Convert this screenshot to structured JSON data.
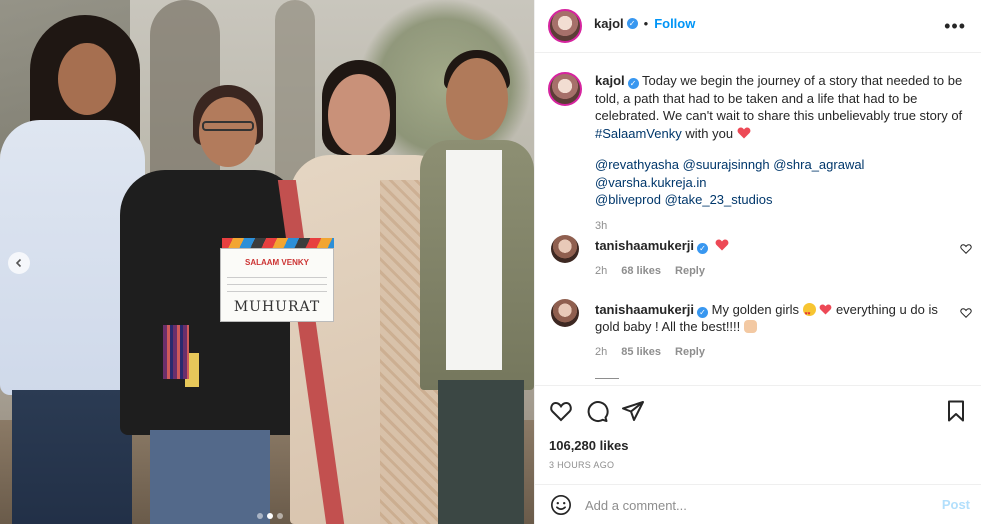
{
  "post": {
    "username": "kajol",
    "follow_label": "Follow",
    "more_icon": "more-dots-icon",
    "caption_text": "Today we begin the journey of a story that needed to be told, a path that had to be taken and a life that had to be celebrated. We can't wait to share this unbelievably true story of",
    "hashtag": "#SalaamVenky",
    "caption_end": "with you",
    "mentions_line1": [
      "@revathyasha",
      "@suurajsinngh",
      "@shra_agrawal",
      "@varsha.kukreja.in"
    ],
    "mentions_line2": [
      "@bliveprod",
      "@take_23_studios"
    ],
    "caption_age": "3h",
    "likes": "106,280 likes",
    "timestamp": "3 HOURS AGO"
  },
  "comments": [
    {
      "username": "tanishaamukerji",
      "text": "",
      "age": "2h",
      "likes": "68 likes",
      "reply_label": "Reply"
    },
    {
      "username": "tanishaamukerji",
      "text_part1": "My golden girls",
      "text_part2": "everything u do is gold baby ! All the best!!!!",
      "age": "2h",
      "likes": "85 likes",
      "reply_label": "Reply"
    }
  ],
  "photo": {
    "clapboard_title": "SALAAM VENKY",
    "clapboard_text": "MUHURAT"
  },
  "add_comment": {
    "placeholder": "Add a comment...",
    "post_label": "Post"
  },
  "colors": {
    "link": "#00376b",
    "follow": "#0095f6",
    "verified": "#3897f0",
    "heart": "#ed4956"
  }
}
